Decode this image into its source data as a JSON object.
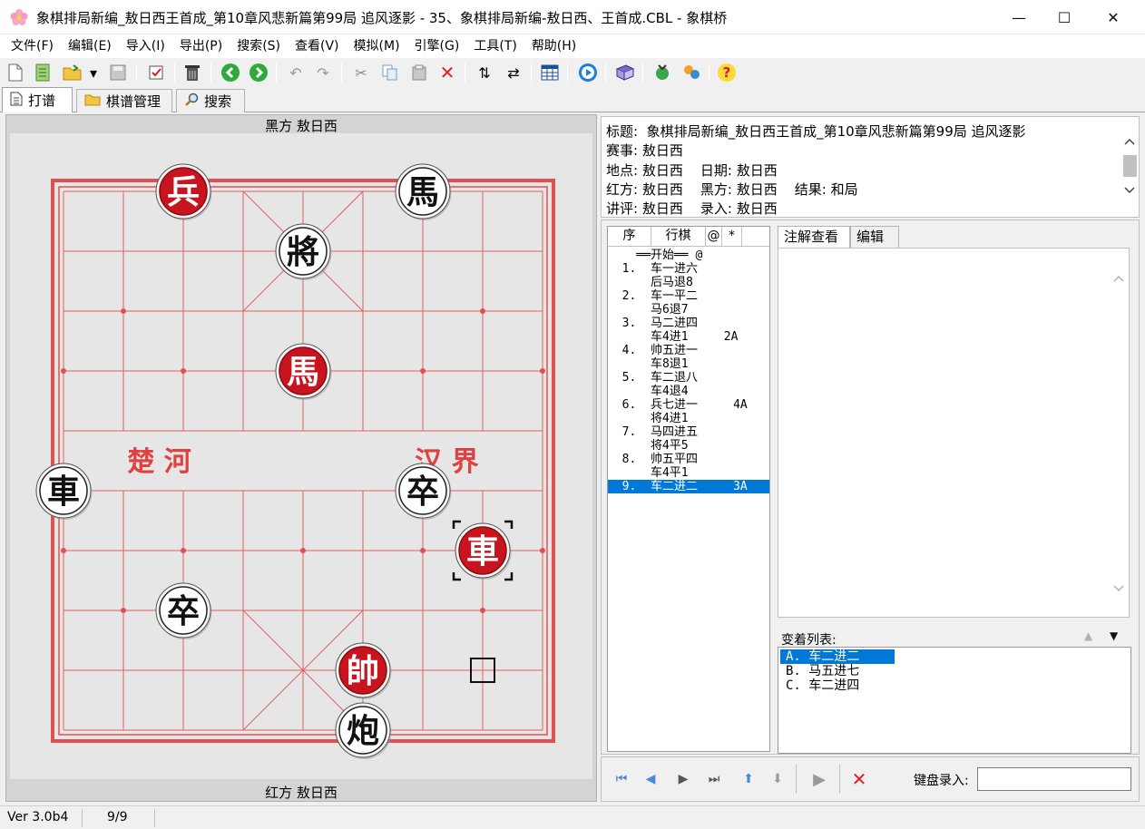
{
  "window": {
    "title": "象棋排局新编_敖日西王首成_第10章风悲新篇第99局 追风逐影 - 35、象棋排局新编-敖日西、王首成.CBL - 象棋桥",
    "minimize": "—",
    "maximize": "☐",
    "close": "✕"
  },
  "menu": [
    "文件(F)",
    "编辑(E)",
    "导入(I)",
    "导出(P)",
    "搜索(S)",
    "查看(V)",
    "模拟(M)",
    "引擎(G)",
    "工具(T)",
    "帮助(H)"
  ],
  "tabs": [
    {
      "label": "打谱",
      "icon": "document-icon"
    },
    {
      "label": "棋谱管理",
      "icon": "folder-icon"
    },
    {
      "label": "搜索",
      "icon": "magnifier-icon"
    }
  ],
  "board": {
    "top_caption": "黑方 敖日西",
    "bottom_caption": "红方 敖日西",
    "river_left": "楚  河",
    "river_right": "汉  界",
    "pieces": [
      {
        "char": "兵",
        "side": "red",
        "file": 2,
        "rank": 0
      },
      {
        "char": "馬",
        "side": "black",
        "file": 6,
        "rank": 0
      },
      {
        "char": "將",
        "side": "black",
        "file": 4,
        "rank": 1
      },
      {
        "char": "馬",
        "side": "red",
        "file": 4,
        "rank": 3
      },
      {
        "char": "車",
        "side": "black",
        "file": 0,
        "rank": 5
      },
      {
        "char": "卒",
        "side": "black",
        "file": 6,
        "rank": 5
      },
      {
        "char": "車",
        "side": "red",
        "file": 7,
        "rank": 6
      },
      {
        "char": "卒",
        "side": "black",
        "file": 2,
        "rank": 7
      },
      {
        "char": "帥",
        "side": "red",
        "file": 5,
        "rank": 8
      },
      {
        "char": "炮",
        "side": "black",
        "file": 5,
        "rank": 9
      }
    ],
    "last_move_to": {
      "file": 7,
      "rank": 6
    },
    "last_move_from": {
      "file": 7,
      "rank": 8
    }
  },
  "info": {
    "title_line": "标题:  象棋排局新编_敖日西王首成_第10章风悲新篇第99局 追风逐影",
    "event_line": "赛事: 敖日西",
    "place_line": "地点: 敖日西    日期: 敖日西",
    "players_line": "红方: 敖日西    黑方: 敖日西    结果: 和局",
    "comment_line": "讲评: 敖日西    录入: 敖日西"
  },
  "moves": {
    "headers": [
      "序",
      "行棋",
      "@",
      "*"
    ],
    "rows": [
      {
        "text": "    ══开始══ @",
        "sel": false
      },
      {
        "text": "  1.  车一进六",
        "sel": false
      },
      {
        "text": "      后马退8",
        "sel": false
      },
      {
        "text": "  2.  车一平二",
        "sel": false
      },
      {
        "text": "      马6退7",
        "sel": false
      },
      {
        "text": "  3.  马二进四",
        "sel": false
      },
      {
        "text": "      车4进1     2A",
        "sel": false
      },
      {
        "text": "  4.  帅五进一",
        "sel": false
      },
      {
        "text": "      车8退1",
        "sel": false
      },
      {
        "text": "  5.  车二退八",
        "sel": false
      },
      {
        "text": "      车4退4",
        "sel": false
      },
      {
        "text": "  6.  兵七进一     4A",
        "sel": false
      },
      {
        "text": "      将4进1",
        "sel": false
      },
      {
        "text": "  7.  马四进五",
        "sel": false
      },
      {
        "text": "      将4平5",
        "sel": false
      },
      {
        "text": "  8.  帅五平四",
        "sel": false
      },
      {
        "text": "      车4平1",
        "sel": false
      },
      {
        "text": "  9.  车二进二     3A",
        "sel": true
      }
    ]
  },
  "annotation": {
    "tab_view": "注解查看",
    "tab_edit": "编辑"
  },
  "variations": {
    "label": "变着列表:",
    "items": [
      "A. 车二进二",
      "B. 马五进七",
      "C. 车二进四"
    ],
    "selected": 0
  },
  "nav": {
    "keyboard_label": "键盘录入:",
    "keyboard_value": ""
  },
  "status": {
    "version": "Ver 3.0b4",
    "position": "9/9"
  }
}
